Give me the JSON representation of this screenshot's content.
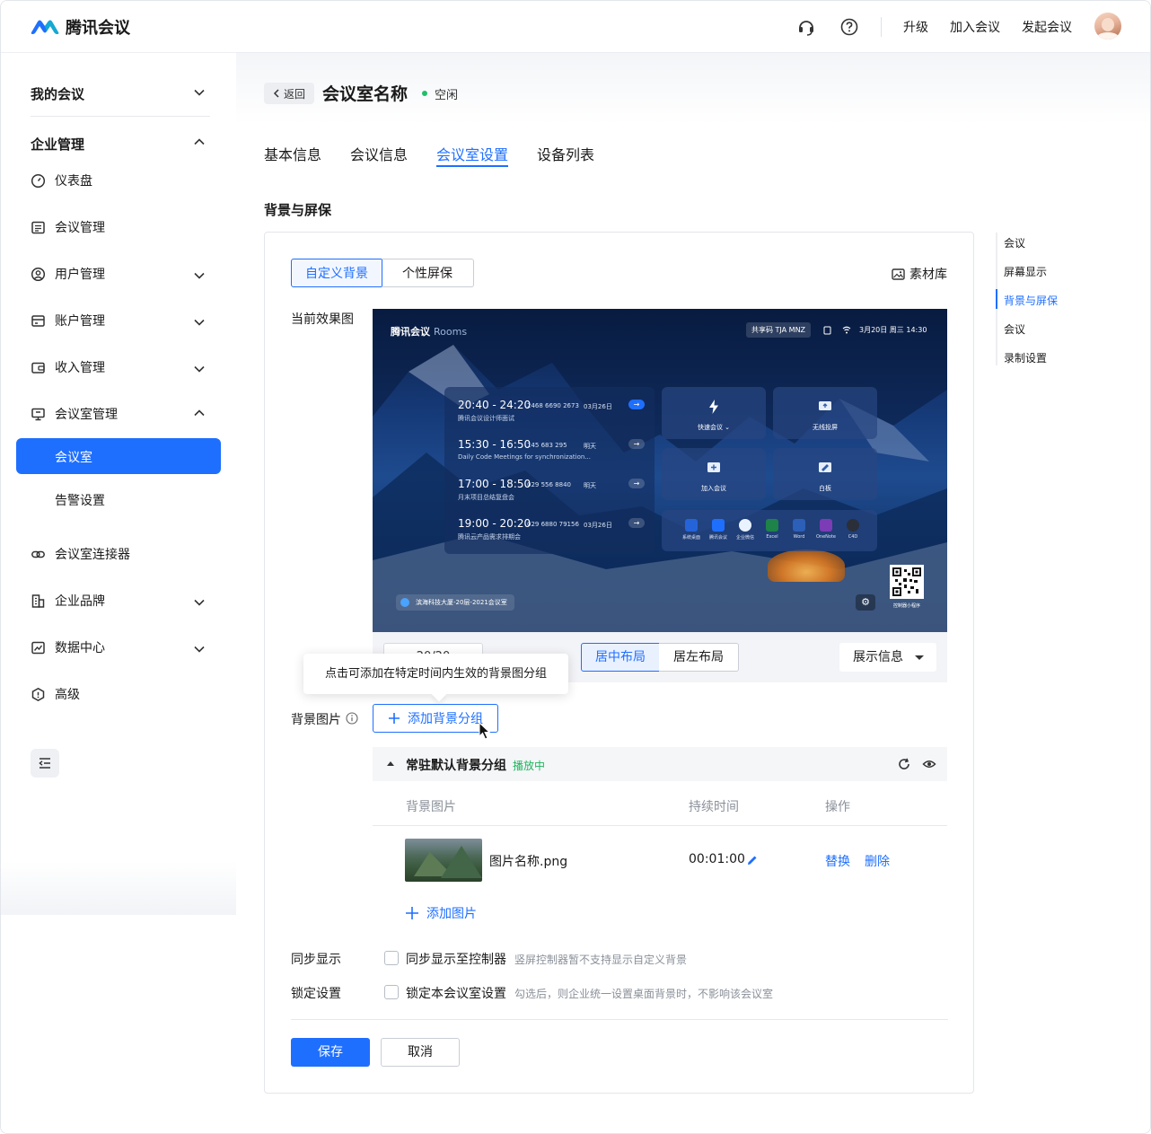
{
  "app": {
    "name": "腾讯会议"
  },
  "header": {
    "links": [
      "升级",
      "加入会议",
      "发起会议"
    ]
  },
  "sidebar": {
    "my_meetings": "我的会议",
    "enterprise": "企业管理",
    "items": [
      {
        "label": "仪表盘",
        "icon": "dashboard-icon"
      },
      {
        "label": "会议管理",
        "icon": "list-icon"
      },
      {
        "label": "用户管理",
        "icon": "user-icon"
      },
      {
        "label": "账户管理",
        "icon": "card-icon"
      },
      {
        "label": "收入管理",
        "icon": "wallet-icon"
      },
      {
        "label": "会议室管理",
        "icon": "monitor-icon"
      },
      {
        "label": "会议室连接器",
        "icon": "link-icon"
      },
      {
        "label": "企业品牌",
        "icon": "building-icon"
      },
      {
        "label": "数据中心",
        "icon": "chart-icon"
      },
      {
        "label": "高级",
        "icon": "shield-icon"
      }
    ],
    "sub_items": [
      "会议室",
      "告警设置"
    ]
  },
  "page": {
    "back": "返回",
    "title": "会议室名称",
    "status": "空闲",
    "tabs": [
      "基本信息",
      "会议信息",
      "会议室设置",
      "设备列表"
    ],
    "section": "背景与屏保"
  },
  "card": {
    "seg": [
      "自定义背景",
      "个性屏保"
    ],
    "library": "素材库",
    "current_effect": "当前效果图",
    "preview": {
      "brand": "腾讯会议",
      "brand_sub": "Rooms",
      "share_code": "共享码 TJA MNZ",
      "datetime": "3月20日 周三 14:30",
      "meetings": [
        {
          "time": "20:40 - 24:20",
          "id": "2468 6690 2673",
          "date": "03月26日",
          "name": "腾讯会议设计师面试"
        },
        {
          "time": "15:30 - 16:50",
          "id": "145 683 295",
          "date": "明天",
          "name": "Daily Code Meetings for synchronization..."
        },
        {
          "time": "17:00 - 18:50",
          "id": "029 556 8840",
          "date": "明天",
          "name": "月末项目总结复盘会"
        },
        {
          "time": "19:00 - 20:20",
          "id": "029 6880 79156",
          "date": "03月26日",
          "name": "腾讯云产品需求排期会"
        }
      ],
      "tiles": [
        "快速会议 ⌄",
        "无线投屏",
        "加入会议",
        "白板"
      ],
      "apps": [
        "系统桌面",
        "腾讯会议",
        "企业微信",
        "Excel",
        "Word",
        "OneNote",
        "C4D"
      ],
      "location": "滨海科技大厦-20层-2021会议室",
      "qr_label": "控制器小程序"
    },
    "pager": "‹  20/20  ›",
    "layouts": [
      "居中布局",
      "居左布局"
    ],
    "info_select": "展示信息",
    "tooltip": "点击可添加在特定时间内生效的背景图分组",
    "bg_label": "背景图片",
    "add_group": "添加背景分组",
    "group_name": "常驻默认背景分组",
    "group_status": "播放中",
    "table_headers": [
      "背景图片",
      "持续时间",
      "操作"
    ],
    "row": {
      "name": "图片名称.png",
      "duration": "00:01:00",
      "replace": "替换",
      "delete": "删除"
    },
    "add_image": "添加图片",
    "sync_label": "同步显示",
    "sync_check": "同步显示至控制器",
    "sync_hint": "竖屏控制器暂不支持显示自定义背景",
    "lock_label": "锁定设置",
    "lock_check": "锁定本会议室设置",
    "lock_hint": "勾选后，则企业统一设置桌面背景时，不影响该会议室",
    "save": "保存",
    "cancel": "取消"
  },
  "anchors": [
    "会议",
    "屏幕显示",
    "背景与屏保",
    "会议",
    "录制设置"
  ],
  "colors": {
    "accent": "#1f6fff",
    "success": "#20b35e"
  }
}
